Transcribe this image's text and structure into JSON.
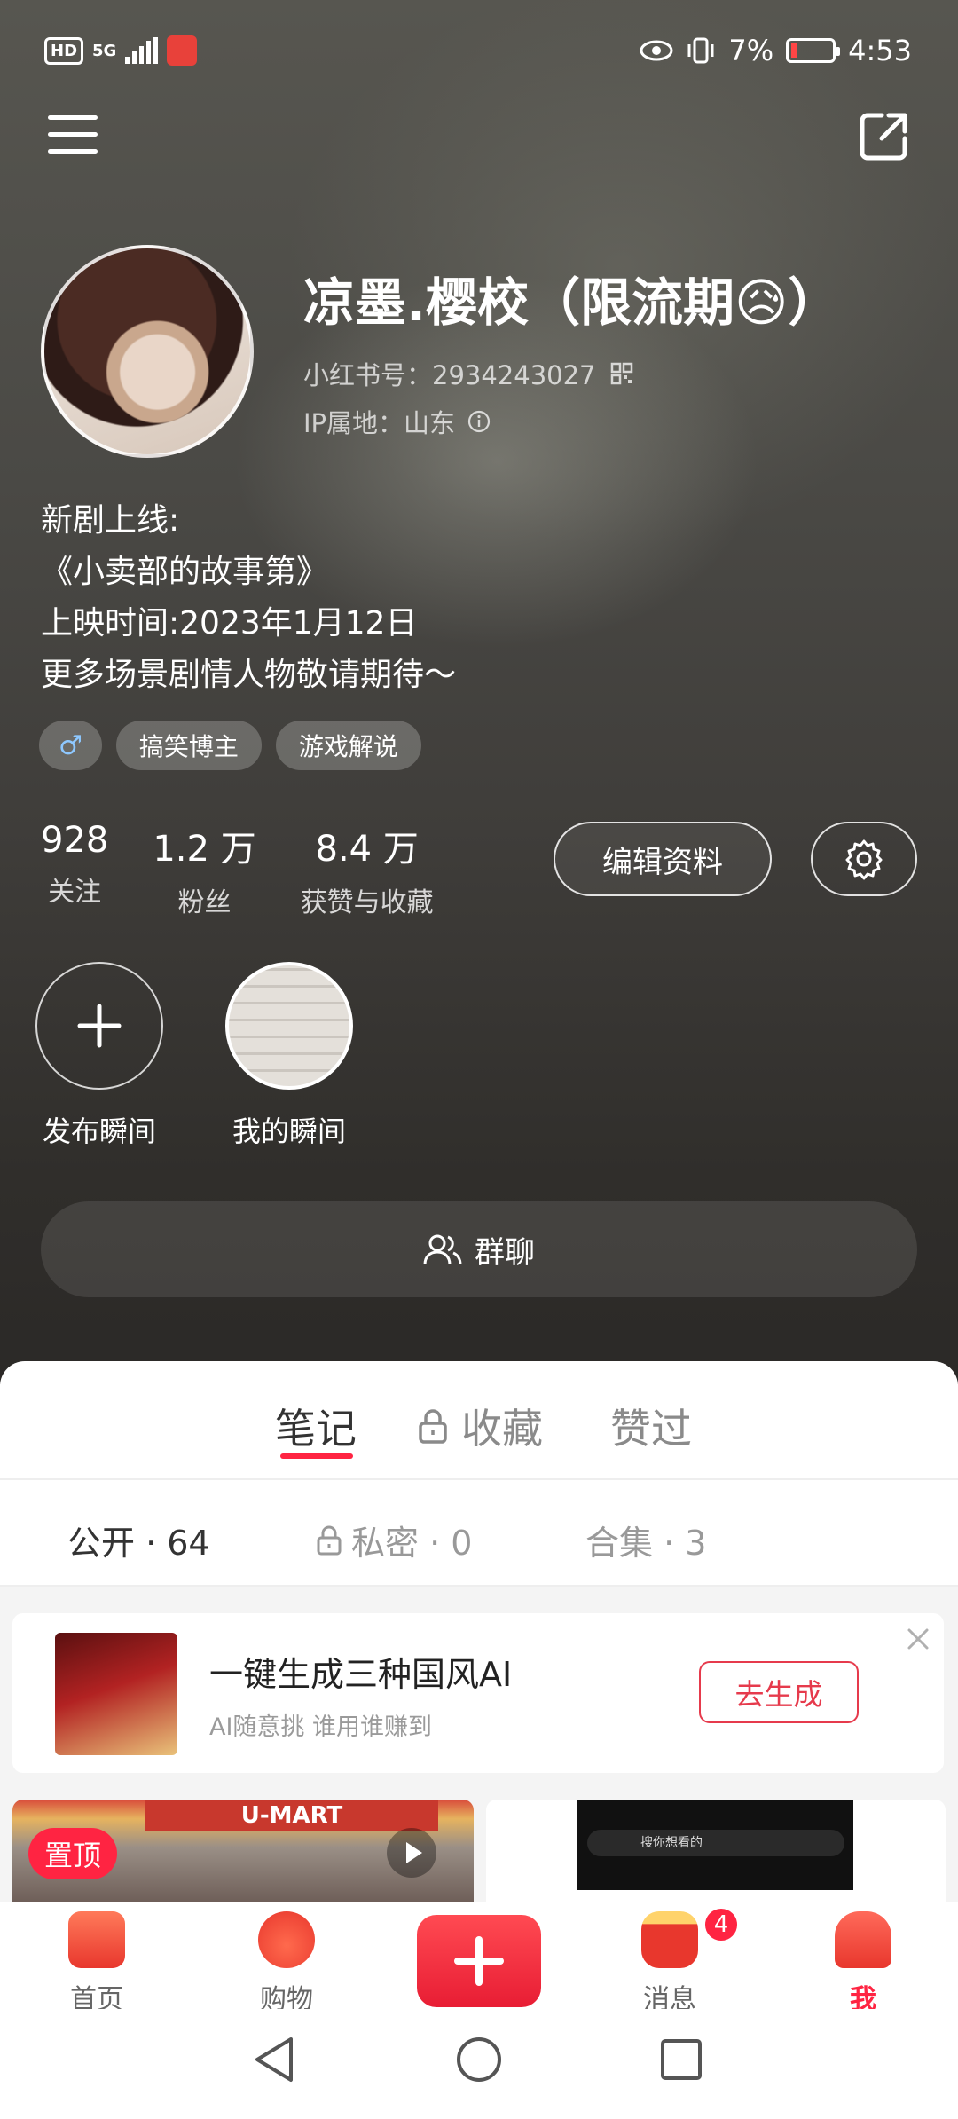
{
  "status_bar": {
    "network": "5G",
    "battery_percent": "7%",
    "time": "4:53"
  },
  "profile": {
    "username": "凉墨.樱校（限流期😥）",
    "red_id": "小红书号：2934243027",
    "ip_location": "IP属地：山东",
    "bio_lines": [
      "新剧上线:",
      "《小卖部的故事第》",
      "上映时间:2023年1月12日",
      "更多场景剧情人物敬请期待～"
    ],
    "tags": [
      "♂",
      "搞笑博主",
      "游戏解说"
    ]
  },
  "stats": [
    {
      "value": "928",
      "label": "关注"
    },
    {
      "value": "1.2 万",
      "label": "粉丝"
    },
    {
      "value": "8.4 万",
      "label": "获赞与收藏"
    }
  ],
  "actions": {
    "edit_profile": "编辑资料"
  },
  "moments": {
    "publish_label": "发布瞬间",
    "mine_label": "我的瞬间"
  },
  "group_chat_label": "群聊",
  "content_tabs": [
    {
      "label": "笔记",
      "active": true
    },
    {
      "label": "收藏",
      "locked": true
    },
    {
      "label": "赞过"
    }
  ],
  "sub_tabs": [
    {
      "label": "公开 · 64",
      "active": true
    },
    {
      "label": "私密 · 0",
      "locked": true
    },
    {
      "label": "合集 · 3"
    }
  ],
  "ad": {
    "title": "一键生成三种国风AI",
    "subtitle": "AI随意挑 谁用谁赚到",
    "button": "去生成"
  },
  "notes": {
    "pin_label": "置顶",
    "store_sign": "U-MART",
    "search_placeholder": "搜你想看的"
  },
  "bottom_nav": [
    {
      "label": "首页"
    },
    {
      "label": "购物"
    },
    {
      "label": "消息",
      "badge": "4"
    },
    {
      "label": "我",
      "active": true
    }
  ],
  "colors": {
    "accent": "#ff2442",
    "header_bg": "#3f3d3a",
    "gender_tag": "#8ec8ff"
  }
}
